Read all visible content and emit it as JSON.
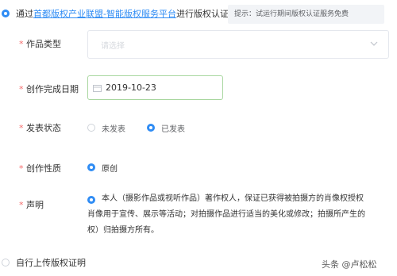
{
  "header": {
    "option_platform_prefix": "通过",
    "option_platform_link": "首都版权产业联盟-智能版权服务平台",
    "option_platform_suffix": "进行版权认证",
    "hint": "提示：试运行期间版权认证服务免费"
  },
  "form": {
    "work_type": {
      "label": "作品类型",
      "placeholder": "请选择"
    },
    "creation_date": {
      "label": "创作完成日期",
      "value": "2019-10-23"
    },
    "publish_status": {
      "label": "发表状态",
      "options": [
        "未发表",
        "已发表"
      ],
      "selected": "已发表"
    },
    "creation_nature": {
      "label": "创作性质",
      "options": [
        "原创"
      ],
      "selected": "原创"
    },
    "declaration": {
      "label": "声明",
      "lines": [
        "本人（摄影作品或视听作品）著作权人，保证已获得被拍摄方的肖像权授权",
        "肖像用于宣传、展示等活动；对拍摄作品进行适当的美化或修改；拍摄所产生的",
        "权）归拍摄方所有。"
      ]
    }
  },
  "footer": {
    "option_self_upload": "自行上传版权证明"
  },
  "watermark": "头条 @卢松松",
  "colors": {
    "accent": "#2f8cf4",
    "required": "#f56c6c",
    "date_border": "#a9d7a0"
  },
  "icons": {
    "select_arrow": "chevron-down-icon",
    "date": "calendar-icon"
  }
}
